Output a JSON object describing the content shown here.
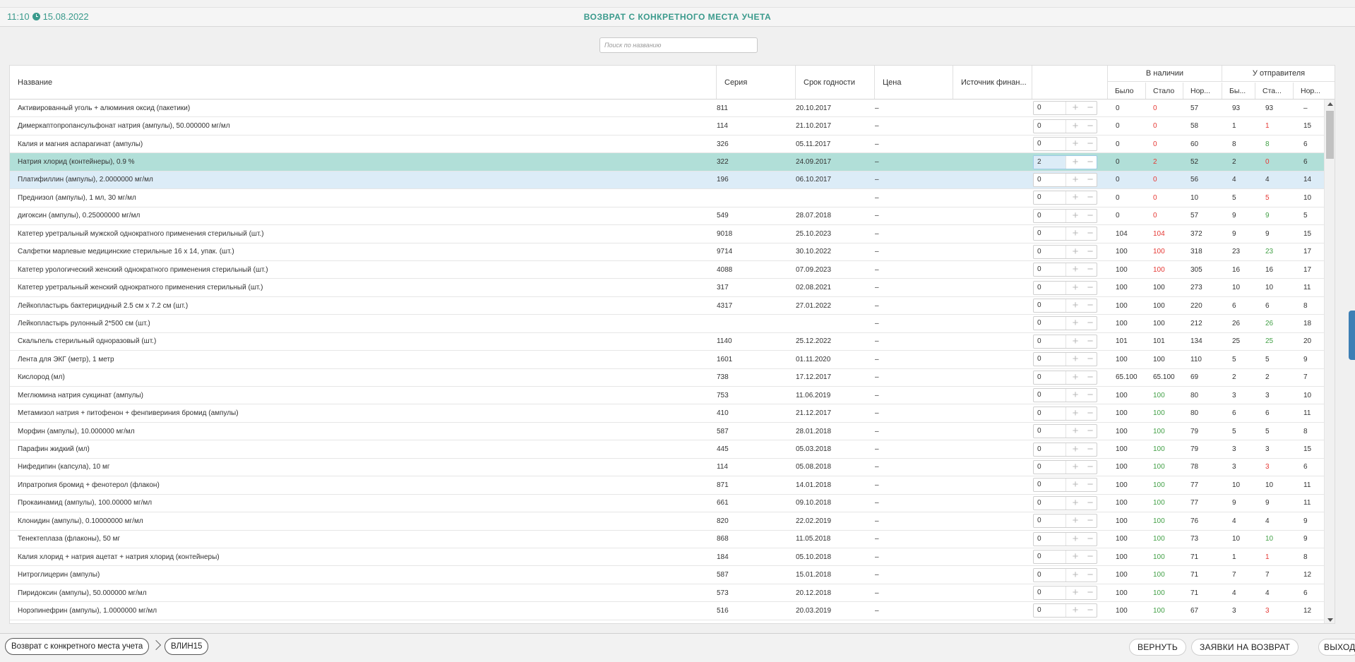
{
  "header": {
    "time": "11:10",
    "date": "15.08.2022",
    "title": "ВОЗВРАТ С КОНКРЕТНОГО МЕСТА УЧЕТА"
  },
  "search": {
    "placeholder": "Поиск по названию"
  },
  "columns": {
    "name": "Название",
    "series": "Серия",
    "expiry": "Срок годности",
    "price": "Цена",
    "source": "Источник финан...",
    "in_stock": "В наличии",
    "at_sender": "У отправителя",
    "was": "Было",
    "became": "Стало",
    "norm": "Нор...",
    "was_short": "Бы...",
    "became_short": "Ста...",
    "norm_short": "Нор..."
  },
  "rows": [
    {
      "name": "Активированный уголь + алюминия оксид (пакетики)",
      "series": "811",
      "expiry": "20.10.2017",
      "price": "–",
      "qty": "0",
      "b1": "0",
      "b2": "0",
      "b2c": "red",
      "b3": "57",
      "s1": "93",
      "s2": "93",
      "s2c": "dark",
      "s3": "–"
    },
    {
      "name": "Димеркаптопропансульфонат натрия (ампулы), 50.000000 мг/мл",
      "series": "114",
      "expiry": "21.10.2017",
      "price": "–",
      "qty": "0",
      "b1": "0",
      "b2": "0",
      "b2c": "red",
      "b3": "58",
      "s1": "1",
      "s2": "1",
      "s2c": "red",
      "s3": "15"
    },
    {
      "name": "Калия и магния аспарагинат (ампулы)",
      "series": "326",
      "expiry": "05.11.2017",
      "price": "–",
      "qty": "0",
      "b1": "0",
      "b2": "0",
      "b2c": "red",
      "b3": "60",
      "s1": "8",
      "s2": "8",
      "s2c": "green",
      "s3": "6"
    },
    {
      "name": "Натрия хлорид (контейнеры), 0.9 %",
      "series": "322",
      "expiry": "24.09.2017",
      "price": "–",
      "qty": "2",
      "b1": "0",
      "b2": "2",
      "b2c": "red",
      "b3": "52",
      "s1": "2",
      "s2": "0",
      "s2c": "red",
      "s3": "6"
    },
    {
      "name": "Платифиллин (ампулы), 2.0000000 мг/мл",
      "series": "196",
      "expiry": "06.10.2017",
      "price": "–",
      "qty": "0",
      "b1": "0",
      "b2": "0",
      "b2c": "red",
      "b3": "56",
      "s1": "4",
      "s2": "4",
      "s2c": "dark",
      "s3": "14"
    },
    {
      "name": "Преднизол (ампулы), 1 мл, 30 мг/мл",
      "series": "",
      "expiry": "",
      "price": "–",
      "qty": "0",
      "b1": "0",
      "b2": "0",
      "b2c": "red",
      "b3": "10",
      "s1": "5",
      "s2": "5",
      "s2c": "red",
      "s3": "10"
    },
    {
      "name": "дигоксин (ампулы), 0.25000000 мг/мл",
      "series": "549",
      "expiry": "28.07.2018",
      "price": "–",
      "qty": "0",
      "b1": "0",
      "b2": "0",
      "b2c": "red",
      "b3": "57",
      "s1": "9",
      "s2": "9",
      "s2c": "green",
      "s3": "5"
    },
    {
      "name": "Катетер уретральный мужской однократного применения стерильный (шт.)",
      "series": "9018",
      "expiry": "25.10.2023",
      "price": "–",
      "qty": "0",
      "b1": "104",
      "b2": "104",
      "b2c": "red",
      "b3": "372",
      "s1": "9",
      "s2": "9",
      "s2c": "dark",
      "s3": "15"
    },
    {
      "name": "Салфетки марлевые медицинские стерильные 16 х 14, упак. (шт.)",
      "series": "9714",
      "expiry": "30.10.2022",
      "price": "–",
      "qty": "0",
      "b1": "100",
      "b2": "100",
      "b2c": "red",
      "b3": "318",
      "s1": "23",
      "s2": "23",
      "s2c": "green",
      "s3": "17"
    },
    {
      "name": "Катетер урологический женский однократного применения стерильный (шт.)",
      "series": "4088",
      "expiry": "07.09.2023",
      "price": "–",
      "qty": "0",
      "b1": "100",
      "b2": "100",
      "b2c": "red",
      "b3": "305",
      "s1": "16",
      "s2": "16",
      "s2c": "dark",
      "s3": "17"
    },
    {
      "name": "Катетер уретральный женский однократного применения стерильный (шт.)",
      "series": "317",
      "expiry": "02.08.2021",
      "price": "–",
      "qty": "0",
      "b1": "100",
      "b2": "100",
      "b2c": "dark",
      "b3": "273",
      "s1": "10",
      "s2": "10",
      "s2c": "dark",
      "s3": "11"
    },
    {
      "name": "Лейкопластырь бактерицидный 2.5 см х 7.2 см (шт.)",
      "series": "4317",
      "expiry": "27.01.2022",
      "price": "–",
      "qty": "0",
      "b1": "100",
      "b2": "100",
      "b2c": "dark",
      "b3": "220",
      "s1": "6",
      "s2": "6",
      "s2c": "dark",
      "s3": "8"
    },
    {
      "name": "Лейкопластырь рулонный 2*500 см (шт.)",
      "series": "",
      "expiry": "",
      "price": "–",
      "qty": "0",
      "b1": "100",
      "b2": "100",
      "b2c": "dark",
      "b3": "212",
      "s1": "26",
      "s2": "26",
      "s2c": "green",
      "s3": "18"
    },
    {
      "name": "Скальпель стерильный одноразовый (шт.)",
      "series": "1140",
      "expiry": "25.12.2022",
      "price": "–",
      "qty": "0",
      "b1": "101",
      "b2": "101",
      "b2c": "dark",
      "b3": "134",
      "s1": "25",
      "s2": "25",
      "s2c": "green",
      "s3": "20"
    },
    {
      "name": "Лента для ЭКГ (метр), 1 метр",
      "series": "1601",
      "expiry": "01.11.2020",
      "price": "–",
      "qty": "0",
      "b1": "100",
      "b2": "100",
      "b2c": "dark",
      "b3": "110",
      "s1": "5",
      "s2": "5",
      "s2c": "dark",
      "s3": "9"
    },
    {
      "name": "Кислород (мл)",
      "series": "738",
      "expiry": "17.12.2017",
      "price": "–",
      "qty": "0",
      "b1": "65.100",
      "b2": "65.100",
      "b2c": "dark",
      "b3": "69",
      "s1": "2",
      "s2": "2",
      "s2c": "dark",
      "s3": "7"
    },
    {
      "name": "Меглюмина натрия сукцинат (ампулы)",
      "series": "753",
      "expiry": "11.06.2019",
      "price": "–",
      "qty": "0",
      "b1": "100",
      "b2": "100",
      "b2c": "green",
      "b3": "80",
      "s1": "3",
      "s2": "3",
      "s2c": "dark",
      "s3": "10"
    },
    {
      "name": "Метамизол натрия + питофенон + фенпивериния бромид (ампулы)",
      "series": "410",
      "expiry": "21.12.2017",
      "price": "–",
      "qty": "0",
      "b1": "100",
      "b2": "100",
      "b2c": "green",
      "b3": "80",
      "s1": "6",
      "s2": "6",
      "s2c": "dark",
      "s3": "11"
    },
    {
      "name": "Морфин (ампулы), 10.000000 мг/мл",
      "series": "587",
      "expiry": "28.01.2018",
      "price": "–",
      "qty": "0",
      "b1": "100",
      "b2": "100",
      "b2c": "green",
      "b3": "79",
      "s1": "5",
      "s2": "5",
      "s2c": "dark",
      "s3": "8"
    },
    {
      "name": "Парафин жидкий (мл)",
      "series": "445",
      "expiry": "05.03.2018",
      "price": "–",
      "qty": "0",
      "b1": "100",
      "b2": "100",
      "b2c": "green",
      "b3": "79",
      "s1": "3",
      "s2": "3",
      "s2c": "dark",
      "s3": "15"
    },
    {
      "name": "Нифедипин (капсула), 10 мг",
      "series": "114",
      "expiry": "05.08.2018",
      "price": "–",
      "qty": "0",
      "b1": "100",
      "b2": "100",
      "b2c": "green",
      "b3": "78",
      "s1": "3",
      "s2": "3",
      "s2c": "red",
      "s3": "6"
    },
    {
      "name": "Ипратропия бромид + фенотерол (флакон)",
      "series": "871",
      "expiry": "14.01.2018",
      "price": "–",
      "qty": "0",
      "b1": "100",
      "b2": "100",
      "b2c": "green",
      "b3": "77",
      "s1": "10",
      "s2": "10",
      "s2c": "dark",
      "s3": "11"
    },
    {
      "name": "Прокаинамид (ампулы), 100.00000 мг/мл",
      "series": "661",
      "expiry": "09.10.2018",
      "price": "–",
      "qty": "0",
      "b1": "100",
      "b2": "100",
      "b2c": "green",
      "b3": "77",
      "s1": "9",
      "s2": "9",
      "s2c": "dark",
      "s3": "11"
    },
    {
      "name": "Клонидин (ампулы), 0.10000000 мг/мл",
      "series": "820",
      "expiry": "22.02.2019",
      "price": "–",
      "qty": "0",
      "b1": "100",
      "b2": "100",
      "b2c": "green",
      "b3": "76",
      "s1": "4",
      "s2": "4",
      "s2c": "dark",
      "s3": "9"
    },
    {
      "name": "Тенектеплаза (флаконы), 50 мг",
      "series": "868",
      "expiry": "11.05.2018",
      "price": "–",
      "qty": "0",
      "b1": "100",
      "b2": "100",
      "b2c": "green",
      "b3": "73",
      "s1": "10",
      "s2": "10",
      "s2c": "green",
      "s3": "9"
    },
    {
      "name": "Калия хлорид + натрия ацетат + натрия хлорид (контейнеры)",
      "series": "184",
      "expiry": "05.10.2018",
      "price": "–",
      "qty": "0",
      "b1": "100",
      "b2": "100",
      "b2c": "green",
      "b3": "71",
      "s1": "1",
      "s2": "1",
      "s2c": "red",
      "s3": "8"
    },
    {
      "name": "Нитроглицерин (ампулы)",
      "series": "587",
      "expiry": "15.01.2018",
      "price": "–",
      "qty": "0",
      "b1": "100",
      "b2": "100",
      "b2c": "green",
      "b3": "71",
      "s1": "7",
      "s2": "7",
      "s2c": "dark",
      "s3": "12"
    },
    {
      "name": "Пиридоксин (ампулы), 50.000000 мг/мл",
      "series": "573",
      "expiry": "20.12.2018",
      "price": "–",
      "qty": "0",
      "b1": "100",
      "b2": "100",
      "b2c": "green",
      "b3": "71",
      "s1": "4",
      "s2": "4",
      "s2c": "dark",
      "s3": "6"
    },
    {
      "name": "Норэпинефрин (ампулы), 1.0000000 мг/мл",
      "series": "516",
      "expiry": "20.03.2019",
      "price": "–",
      "qty": "0",
      "b1": "100",
      "b2": "100",
      "b2c": "green",
      "b3": "67",
      "s1": "3",
      "s2": "3",
      "s2c": "red",
      "s3": "12"
    }
  ],
  "selected_row": 3,
  "hovered_row": 4,
  "footer": {
    "crumb1": "Возврат с конкретного места учета",
    "crumb2": "ВЛИН15",
    "btn_return": "ВЕРНУТЬ",
    "btn_requests": "ЗАЯВКИ НА ВОЗВРАТ",
    "btn_exit": "ВЫХОД"
  },
  "colors": {
    "accent": "#3a9a8c",
    "selected_row": "#b1dfd8",
    "hover_row": "#dcecf7",
    "red": "#e53935",
    "green": "#43a047",
    "side_tab": "#3d7fb5"
  },
  "icons": {
    "clock": "clock-icon",
    "plus": "plus-icon",
    "minus": "minus-icon",
    "chevron": "chevron-right-icon"
  }
}
